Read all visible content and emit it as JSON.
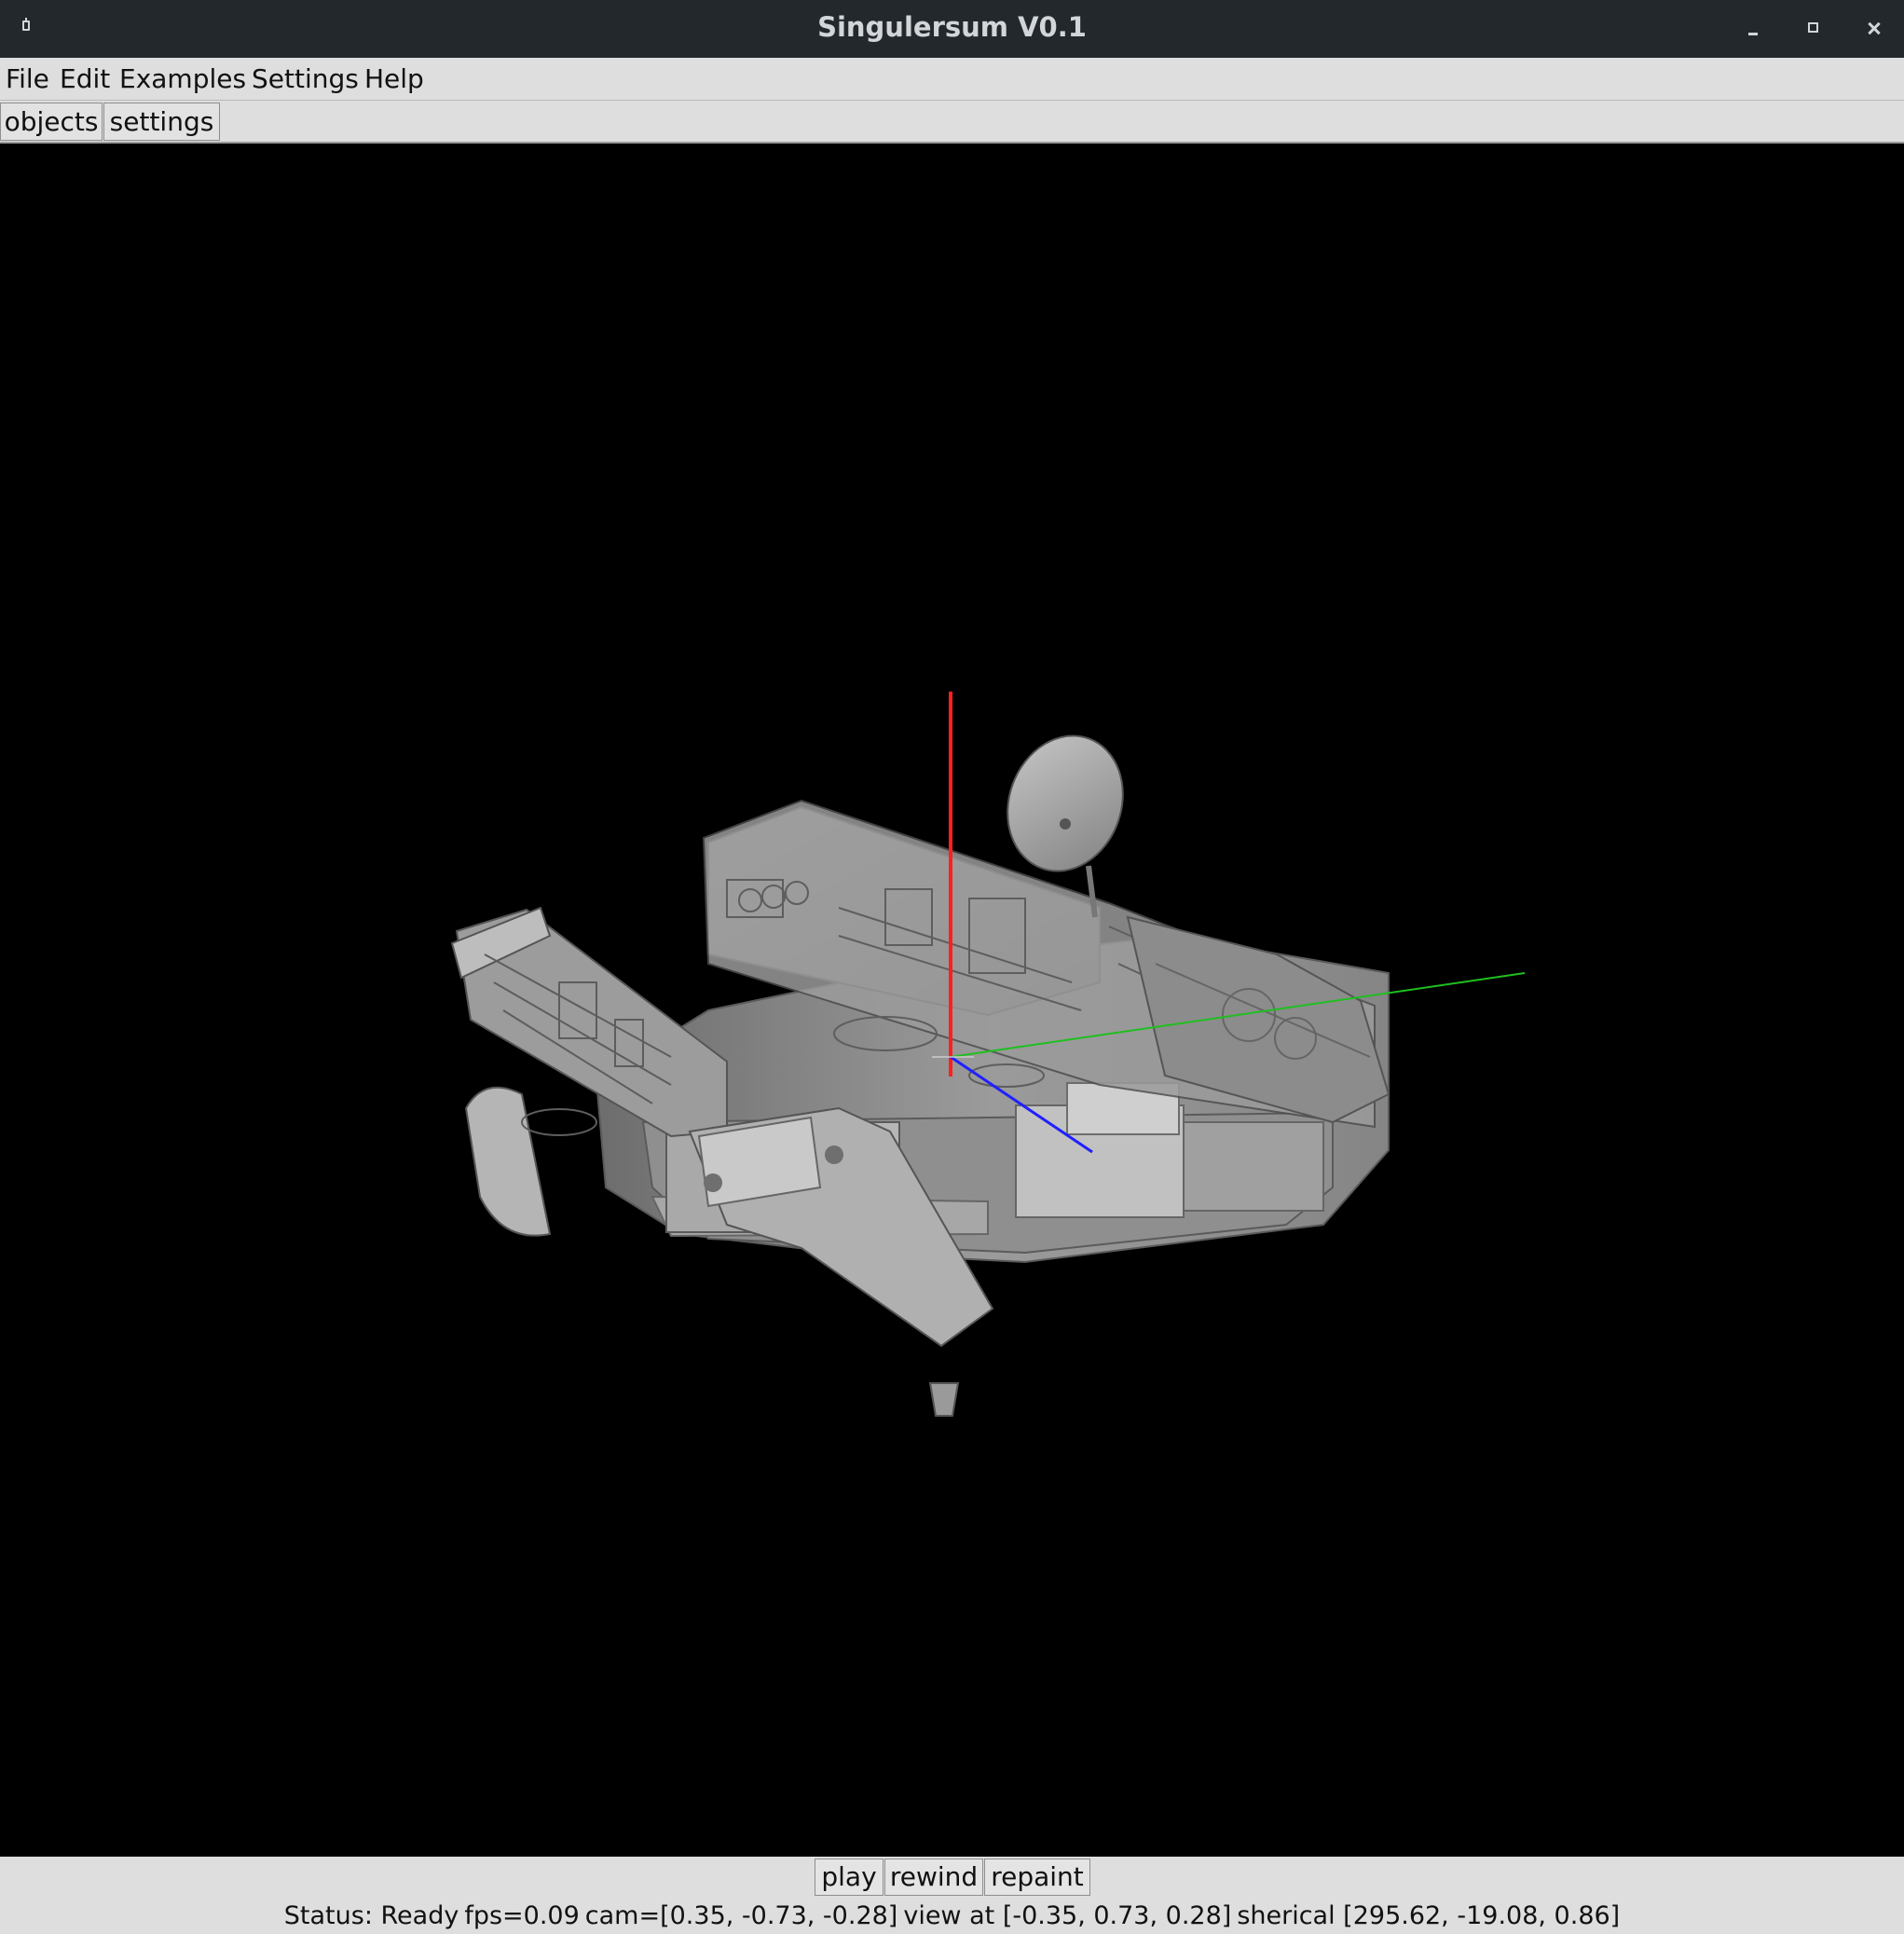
{
  "window": {
    "title": "Singulersum V0.1"
  },
  "menu": {
    "file": "File",
    "edit": "Edit",
    "examples": "Examples",
    "settings": "Settings",
    "help": "Help"
  },
  "tabs": {
    "objects": "objects",
    "settings": "settings"
  },
  "controls": {
    "play": "play",
    "rewind": "rewind",
    "repaint": "repaint"
  },
  "status": {
    "state": "Status: Ready",
    "fps": "fps=0.09",
    "cam": "cam=[0.35, -0.73, -0.28]",
    "view_at": "view at [-0.35, 0.73, 0.28]",
    "spherical": "sherical [295.62, -19.08, 0.86]"
  },
  "scene": {
    "background_color": "#000000",
    "model_color": "#8a8a8a",
    "axis_colors": {
      "x": "#ff2020",
      "y": "#1fbf1f",
      "z": "#2020ff"
    }
  }
}
